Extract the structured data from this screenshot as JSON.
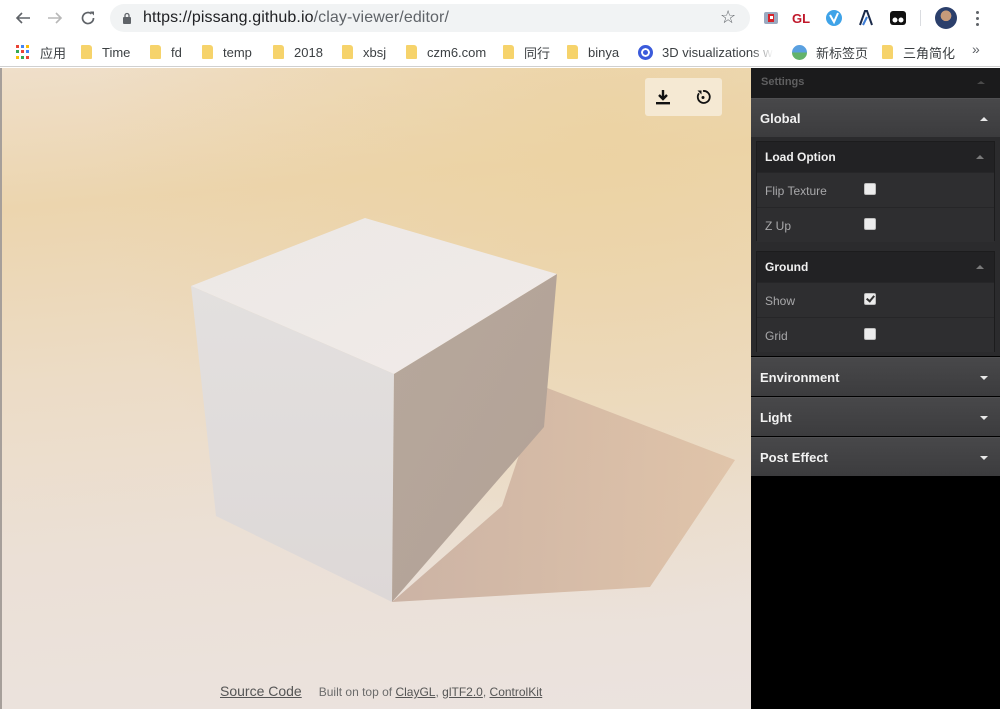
{
  "browser": {
    "url_host": "https://pissang.github.io",
    "url_path": "/clay-viewer/editor/",
    "extensions": [
      "redux-devtools-icon",
      "gl-extension",
      "v-extension",
      "lambda-extension",
      "tampermonkey-icon"
    ],
    "extension_gl_label": "GL",
    "bookmarks": [
      {
        "label": "应用",
        "icon": "apps-grid-icon"
      },
      {
        "label": "Time",
        "icon": "folder-icon"
      },
      {
        "label": "fd",
        "icon": "folder-icon"
      },
      {
        "label": "temp",
        "icon": "folder-icon"
      },
      {
        "label": "2018",
        "icon": "folder-icon"
      },
      {
        "label": "xbsj",
        "icon": "folder-icon"
      },
      {
        "label": "czm6.com",
        "icon": "folder-icon"
      },
      {
        "label": "同行",
        "icon": "folder-icon"
      },
      {
        "label": "binya",
        "icon": "folder-icon"
      },
      {
        "label": "3D visualizations w",
        "icon": "site-icon"
      },
      {
        "label": "新标签页",
        "icon": "site-icon"
      },
      {
        "label": "三角简化",
        "icon": "folder-icon"
      }
    ],
    "more_bookmarks": "»"
  },
  "viewport": {
    "tools": [
      {
        "name": "download",
        "icon": "download-icon"
      },
      {
        "name": "reset",
        "icon": "reset-icon"
      }
    ],
    "footer": {
      "source_code": "Source Code",
      "built_on": "Built on top of",
      "links": [
        "ClayGL",
        "glTF2.0",
        "ControlKit"
      ],
      "separator": ","
    }
  },
  "settings": {
    "title": "Settings",
    "groups": [
      {
        "label": "Global",
        "expanded": true,
        "subgroups": [
          {
            "label": "Load Option",
            "rows": [
              {
                "label": "Flip Texture",
                "checked": false
              },
              {
                "label": "Z Up",
                "checked": false
              }
            ]
          },
          {
            "label": "Ground",
            "rows": [
              {
                "label": "Show",
                "checked": true
              },
              {
                "label": "Grid",
                "checked": false
              }
            ]
          }
        ]
      },
      {
        "label": "Environment",
        "expanded": false
      },
      {
        "label": "Light",
        "expanded": false
      },
      {
        "label": "Post Effect",
        "expanded": false
      }
    ]
  }
}
